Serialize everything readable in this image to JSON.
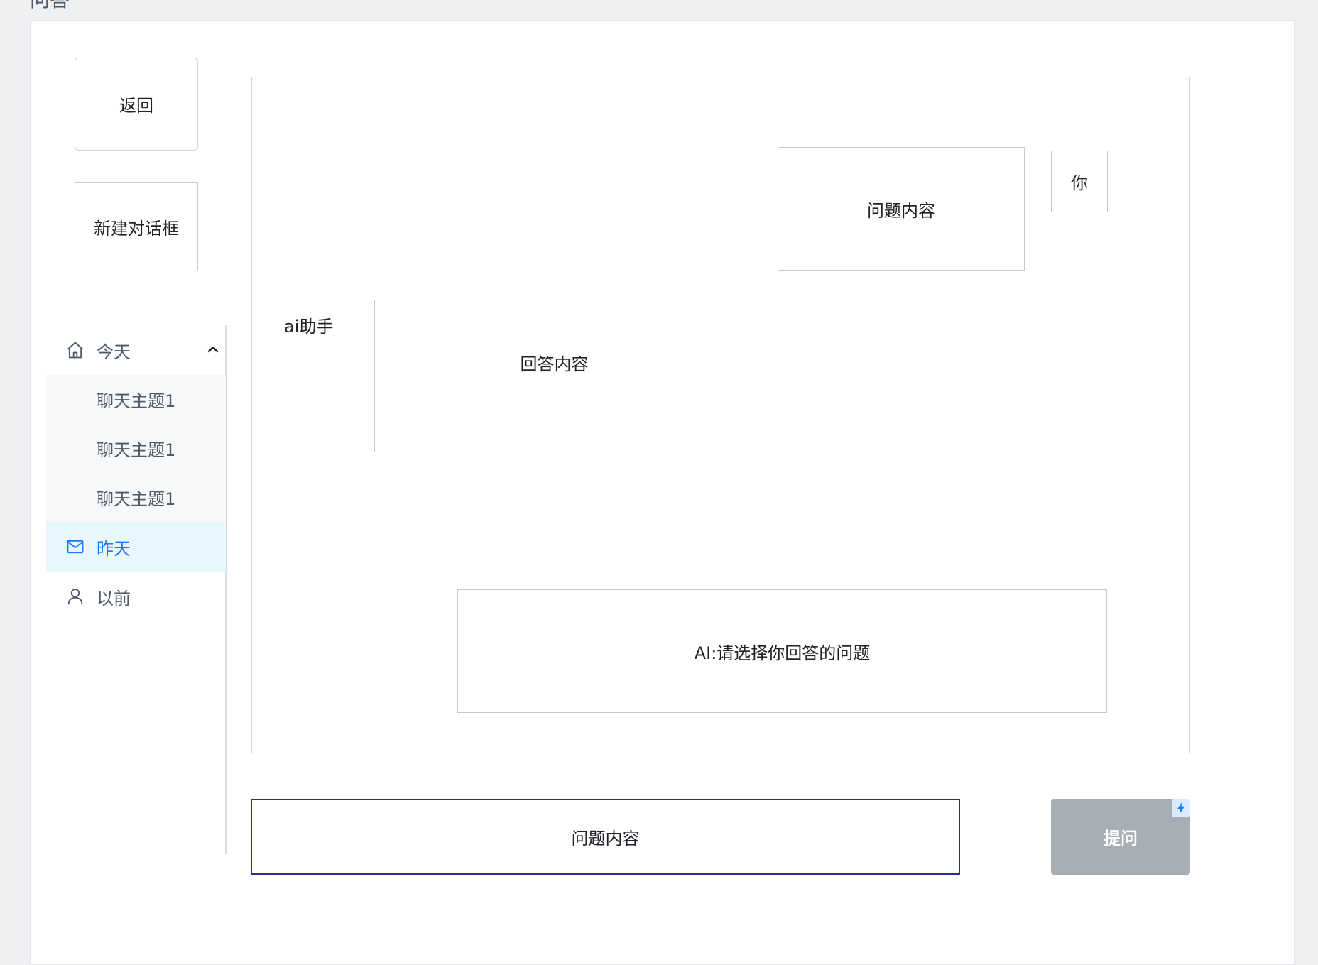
{
  "page": {
    "title": "问答"
  },
  "sidebar": {
    "back_label": "返回",
    "new_dialog_label": "新建对话框",
    "menu": {
      "today": {
        "label": "今天",
        "icon": "home-icon"
      },
      "today_items": [
        {
          "label": "聊天主题1"
        },
        {
          "label": "聊天主题1"
        },
        {
          "label": "聊天主题1"
        }
      ],
      "yesterday": {
        "label": "昨天",
        "icon": "mail-icon"
      },
      "before": {
        "label": "以前",
        "icon": "user-icon"
      }
    }
  },
  "chat": {
    "user_question": "问题内容",
    "user_tag": "你",
    "ai_label": "ai助手",
    "ai_answer": "回答内容",
    "ai_prompt": "AI:请选择你回答的问题"
  },
  "composer": {
    "input_value": "问题内容",
    "submit_label": "提问"
  },
  "colors": {
    "active_accent": "#1677ff",
    "active_bg": "#e8f6fd",
    "submit_bg": "#a7aeb6",
    "input_border": "#2b2f8f"
  }
}
